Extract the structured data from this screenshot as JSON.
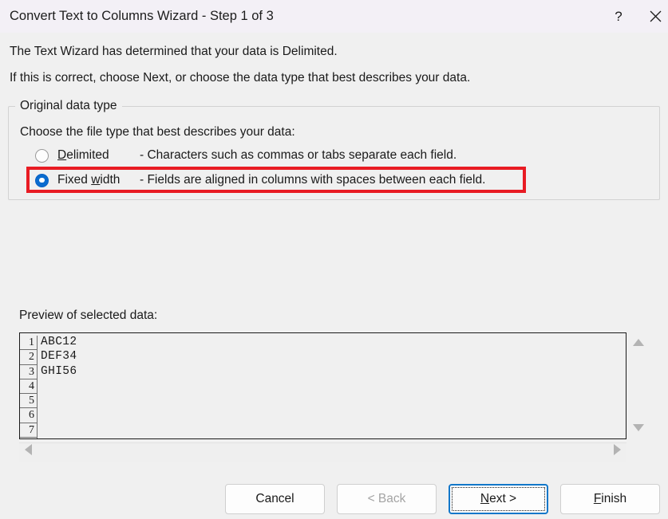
{
  "titlebar": {
    "title": "Convert Text to Columns Wizard - Step 1 of 3",
    "help_label": "?",
    "help_icon": "question-mark-icon",
    "close_icon": "close-x-icon",
    "background": "#f3f0f6"
  },
  "body": {
    "line1": "The Text Wizard has determined that your data is Delimited.",
    "line2": "If this is correct, choose Next, or choose the data type that best describes your data.",
    "background": "#f0f0f0"
  },
  "group": {
    "legend": "Original data type",
    "instruction": "Choose the file type that best describes your data:",
    "options": [
      {
        "name": "Delimited",
        "accel_prefix": "",
        "accel_char": "D",
        "accel_suffix": "elimited",
        "description": "- Characters such as commas or tabs separate each field.",
        "selected": false
      },
      {
        "name": "Fixed width",
        "accel_prefix": "Fixed ",
        "accel_char": "w",
        "accel_suffix": "idth",
        "description": "- Fields are aligned in columns with spaces between each field.",
        "selected": true
      }
    ],
    "highlight_color": "#e81b23",
    "highlight_target": "Fixed width"
  },
  "preview": {
    "label": "Preview of selected data:",
    "rows": [
      {
        "number": "1",
        "text": "ABC12"
      },
      {
        "number": "2",
        "text": "DEF34"
      },
      {
        "number": "3",
        "text": "GHI56"
      },
      {
        "number": "4",
        "text": ""
      },
      {
        "number": "5",
        "text": ""
      },
      {
        "number": "6",
        "text": ""
      },
      {
        "number": "7",
        "text": ""
      }
    ],
    "scroll_up_icon": "triangle-up-icon",
    "scroll_down_icon": "triangle-down-icon",
    "scroll_left_icon": "triangle-left-icon",
    "scroll_right_icon": "triangle-right-icon"
  },
  "buttons": {
    "cancel": {
      "label": "Cancel",
      "enabled": true,
      "focused": false
    },
    "back": {
      "label": "< Back",
      "enabled": false,
      "focused": false
    },
    "next": {
      "accel_prefix": "",
      "accel_char": "N",
      "accel_suffix": "ext >",
      "label": "Next >",
      "enabled": true,
      "focused": true,
      "focus_color": "#1277c9"
    },
    "finish": {
      "accel_prefix": "",
      "accel_char": "F",
      "accel_suffix": "inish",
      "label": "Finish",
      "enabled": true,
      "focused": false
    }
  }
}
